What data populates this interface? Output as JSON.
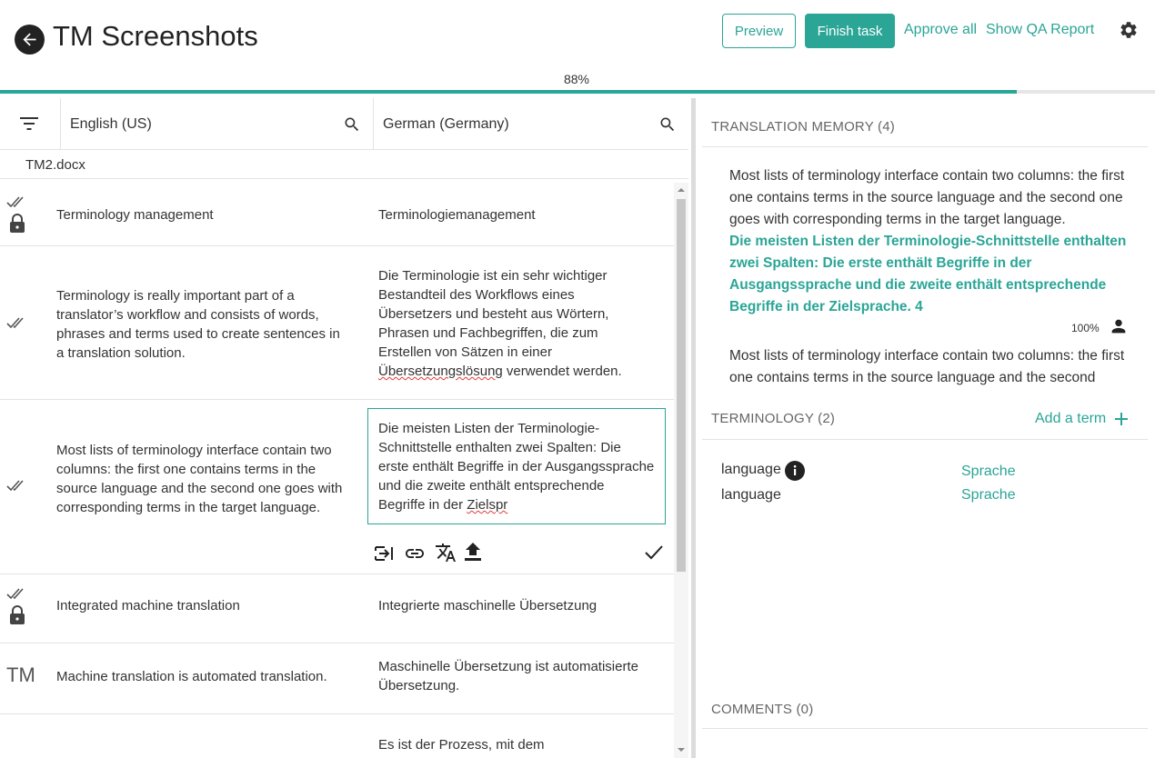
{
  "header": {
    "title": "TM Screenshots",
    "preview_label": "Preview",
    "finish_label": "Finish task",
    "approve_all_label": "Approve all",
    "qa_report_label": "Show QA Report",
    "progress_label": "88%",
    "progress_value": 0.88
  },
  "languages": {
    "source": "English (US)",
    "target": "German (Germany)"
  },
  "file_name": "TM2.docx",
  "segments": [
    {
      "status": "confirmed-locked",
      "source": "Terminology management",
      "target": "Terminologiemanagement"
    },
    {
      "status": "confirmed",
      "source": "Terminology is really important part of a translator’s workflow and consists of words, phrases and terms used to create sentences in a translation solution.",
      "target_before": "Die Terminologie ist ein sehr wichtiger Bestandteil des Workflows eines Übersetzers und besteht aus Wörtern, Phrasen und Fachbegriffen, die zum Erstellen von Sätzen in einer ",
      "target_spell": "Übersetzungslösung",
      "target_after": " verwendet werden."
    },
    {
      "status": "confirmed",
      "source": "Most lists of terminology interface contain two columns: the first one contains terms in the source language and the second one goes with corresponding terms in the target language.",
      "target_before": "Die meisten Listen der Terminologie-Schnittstelle enthalten zwei Spalten: Die erste enthält Begriffe in der Ausgangssprache und die zweite enthält entsprechende Begriffe in der ",
      "target_spell": "Zielspr",
      "target_after": ""
    },
    {
      "status": "confirmed-locked",
      "source": "Integrated machine translation",
      "target": "Integrierte maschinelle Übersetzung"
    },
    {
      "status": "TM",
      "source": "Machine translation is automated translation.",
      "target": "Maschinelle Übersetzung ist automatisierte Übersetzung."
    },
    {
      "status": "",
      "source": "",
      "target": "Es ist der Prozess, mit dem"
    }
  ],
  "editor_tools": [
    "insert-source-icon",
    "link-icon",
    "translate-icon",
    "upload-icon",
    "confirm-check-icon"
  ],
  "translation_memory": {
    "heading": "TRANSLATION MEMORY (4)",
    "match_source": "Most lists of terminology interface contain two columns: the first one contains terms in the source language and the second one goes with corresponding terms in the target language.",
    "match_target": "Die meisten Listen der Terminologie-Schnittstelle enthalten zwei Spalten: Die erste enthält Begriffe in der Ausgangssprache und die zweite enthält entsprechende Begriffe in der Zielsprache. 4",
    "match_score": "100%",
    "next_source": "Most lists of terminology interface contain two columns: the first one contains terms in the source language and the second"
  },
  "terminology": {
    "heading": "TERMINOLOGY (2)",
    "add_label": "Add a term",
    "terms": [
      {
        "source": "language",
        "target": "Sprache"
      },
      {
        "source": "language",
        "target": "Sprache"
      }
    ]
  },
  "comments": {
    "heading": "COMMENTS (0)"
  },
  "colors": {
    "accent": "#2aa596",
    "spellcheck": "#e23b3b"
  }
}
